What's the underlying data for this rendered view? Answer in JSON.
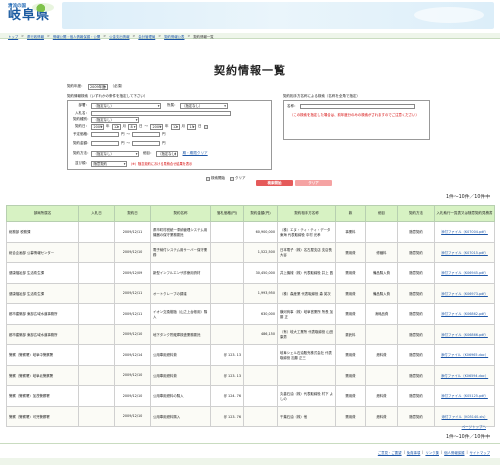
{
  "logo": {
    "tagline": "清流の国",
    "name": "岐阜県"
  },
  "breadcrumbs": [
    "トップ",
    "県行政情報",
    "情報公開・個人情報保護・公開",
    "公金支出情報",
    "会計管理局",
    "契約情報公表",
    "契約情報一覧"
  ],
  "page_title": "契約情報一覧",
  "form": {
    "year_label": "契約年度：",
    "year_value": "2009年度",
    "required_mark": "（必須）",
    "agency_section_label": "契約情報検索（いずれかの条件を指定して下さい）",
    "dept_label": "部署：",
    "dept_value": "（指定なし）",
    "division_label": "所属：",
    "division_value": "（指定なし）",
    "bidder_label": "入札名：",
    "category_label": "契約種別：",
    "category_value": "（指定なし）",
    "period_label": "契約日：",
    "date_from": {
      "year": "2009",
      "month": "12",
      "day": "8"
    },
    "date_to": {
      "year": "2009",
      "month": "12",
      "day": "15"
    },
    "date_unit_year": "年",
    "date_unit_month": "月",
    "date_unit_day": "日",
    "range_tilde": "〜",
    "amount_label": "予定価格：",
    "contract_amount_label": "契約金額：",
    "yen": "円",
    "method_label": "契約方法：",
    "method_value": "（指定なし）",
    "extra_label": "細目：",
    "extra_value": "（指定なし）",
    "clear_date_link": "期・期限クリア",
    "sort_label": "並び順：",
    "sort_value": "随意契約",
    "sort_note": "（※）随意契約における見積合せ結果を表示",
    "supplier_section_label": "契約相手方名称による検索（名称を全角で指定）",
    "supplier_name_label": "名称：",
    "supplier_note": "（この検索を指定した場合は、前年度分のみの検索がされますのでご注意ください）",
    "search_start_label": "検索開始",
    "clear_label": "クリア",
    "search_button": "検索開始",
    "clear_button": "クリア"
  },
  "count_text": "1件～10件／10件中",
  "table": {
    "headers": [
      "部局所属名",
      "入札日",
      "契約日",
      "契約名称",
      "落札価格(円)",
      "契約金額(円)",
      "契約相手方名称",
      "款",
      "細目",
      "契約方法",
      "入札執行一覧表又は随意契約見積書"
    ],
    "rows": [
      [
        "総務部 税務課",
        "",
        "2009/12/11",
        "県市町村税統一滞納管理システム用機器の保守業務委託",
        "",
        "60,900,000",
        "（株）エヌ・ティ・ティ・データ東海 代表取締役 中村 光孝",
        "事業料",
        "",
        "随意契約",
        "添付ファイル（K07004.pdf）"
      ],
      [
        "総合企画部 公募情報センター",
        "",
        "2009/12/10",
        "電子納付システム用サーバー保守業務",
        "",
        "1,522,500",
        "日本電子（株）名古屋支店 支店長 大谷",
        "需用費",
        "修繕料",
        "随意契約",
        "添付ファイル（K07015.pdf）"
      ],
      [
        "健康福祉部 生活衛生課",
        "",
        "2009/12/09",
        "新型インフルエンザ診療用資材",
        "",
        "30,450,000",
        "井上機械（株）代表取締役 井上 昌",
        "需用費",
        "備品購入費",
        "随意契約",
        "添付ファイル（K06945.pdf）"
      ],
      [
        "健康福祉部 生活衛生課",
        "",
        "2009/12/11",
        "オートクレーブの調達",
        "",
        "1,993,950",
        "（株）森産業 代表取締役 森 英次",
        "需用費",
        "備品購入費",
        "随意契約",
        "添付ファイル（K06973.pdf）"
      ],
      [
        "都市建築部 東部広域水道事務所",
        "",
        "2009/12/11",
        "イオン交換樹脂（山之上台帳用）購入",
        "",
        "630,000",
        "横河商事（株）岐阜営業所 所長 加藤 正",
        "需用費",
        "消耗品費",
        "随意契約",
        "添付ファイル（K06862.pdf）"
      ],
      [
        "都市建築部 東部広域水道事務所",
        "",
        "2009/12/10",
        "地下タンク貯蔵庫検査業務委託",
        "",
        "486,150",
        "（有）岐大工業所 代表取締役 山田 康男",
        "委託料",
        "",
        "随意契約",
        "添付ファイル（K06866.pdf）"
      ],
      [
        "警察（警察署）岐阜中警察署",
        "",
        "2009/12/14",
        "公用車用燃料費",
        "＠ 123. 13",
        "",
        "岐阜シェル石油販売株式会社 代表取締役 加藤 正三",
        "需用費",
        "燃料費",
        "随意契約",
        "添付ファイル（K06965.doc）"
      ],
      [
        "警察（警察署）岐阜北警察署",
        "",
        "2009/12/10",
        "公用車用燃料費",
        "＠ 123. 13",
        "",
        "",
        "需用費",
        "",
        "随意契約",
        "添付ファイル（K06594.doc）"
      ],
      [
        "警察（警察署）加茂警察署",
        "",
        "2009/12/10",
        "公用車用燃料の購入",
        "＠ 124. 76",
        "",
        "丸善石油（株）代表取締役 村下 よしの",
        "需用費",
        "燃料費",
        "随意契約",
        "添付ファイル（K05125.pdf）"
      ],
      [
        "警察（警察署）可児警察署",
        "",
        "2009/12/10",
        "公用車用燃料購入",
        "＠ 123. 76",
        "",
        "千葉石油（株）他",
        "需用費",
        "燃料費",
        "随意契約",
        "添付ファイル（K05140.xls）"
      ]
    ]
  },
  "page_top_link": "ページトップへ",
  "footer_links": [
    "ご意見・ご要望",
    "免責事項",
    "リンク集",
    "個人情報保護",
    "サイトマップ"
  ],
  "colors": {
    "header_green": "#d7f2c3",
    "link_blue": "#1d57a8",
    "button_red": "#f5a3a3",
    "button_red_dark": "#e55a5a"
  }
}
